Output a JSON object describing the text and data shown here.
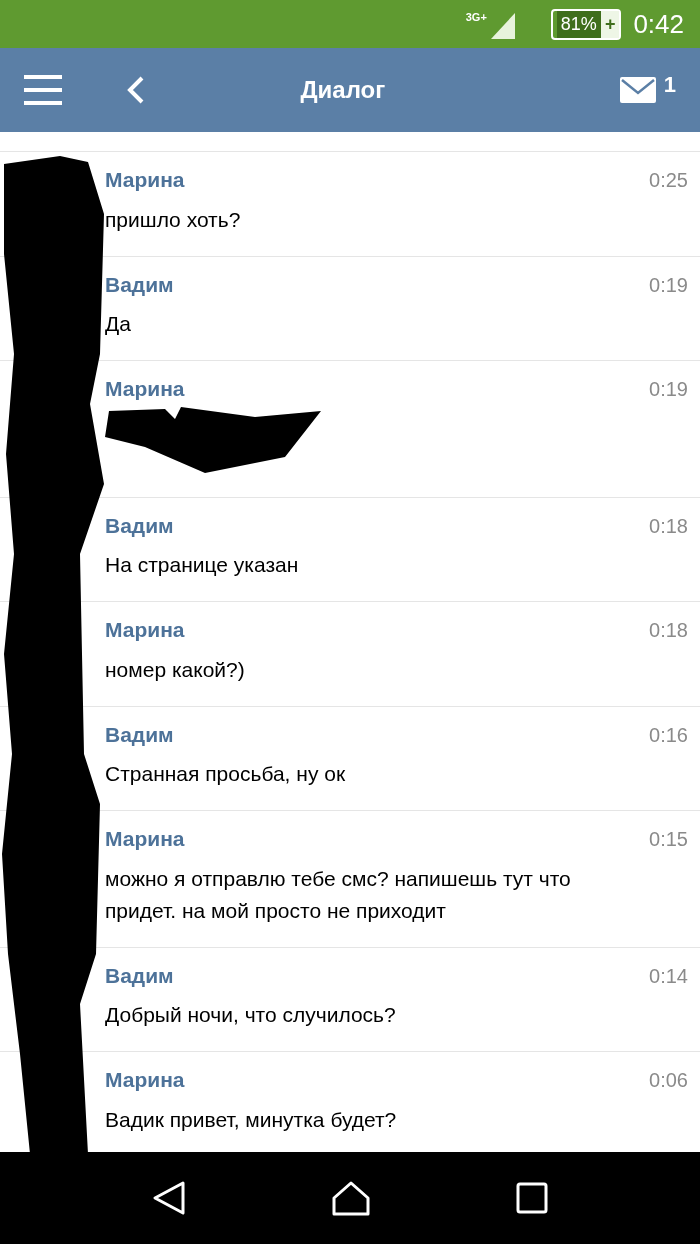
{
  "status_bar": {
    "network": "3G+",
    "battery": "81%",
    "charge_sign": "+",
    "time": "0:42"
  },
  "header": {
    "title": "Диалог",
    "unread_count": "1"
  },
  "messages": [
    {
      "sender": "Марина",
      "time": "0:25",
      "text": "пришло хоть?",
      "redacted": false
    },
    {
      "sender": "Вадим",
      "time": "0:19",
      "text": "Да",
      "redacted": false
    },
    {
      "sender": "Марина",
      "time": "0:19",
      "redacted": true
    },
    {
      "sender": "Вадим",
      "time": "0:18",
      "text": "На странице указан",
      "redacted": false
    },
    {
      "sender": "Марина",
      "time": "0:18",
      "text": "номер какой?)",
      "redacted": false
    },
    {
      "sender": "Вадим",
      "time": "0:16",
      "text": "Странная просьба, ну ок",
      "redacted": false
    },
    {
      "sender": "Марина",
      "time": "0:15",
      "text": "можно я отправлю тебе смс? напишешь тут что придет. на мой просто не приходит",
      "redacted": false
    },
    {
      "sender": "Вадим",
      "time": "0:14",
      "text": "Добрый ночи, что случилось?",
      "redacted": false
    },
    {
      "sender": "Марина",
      "time": "0:06",
      "text": "Вадик привет, минутка будет?",
      "redacted": false
    }
  ]
}
